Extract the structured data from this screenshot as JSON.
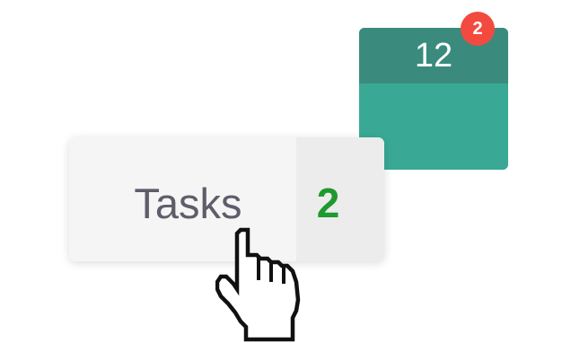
{
  "calendar": {
    "date_label": "12",
    "notification_count": "2",
    "colors": {
      "header": "#3a8b7d",
      "body": "#39a996",
      "badge": "#f24a3f"
    }
  },
  "tasks": {
    "label": "Tasks",
    "count": "2",
    "colors": {
      "label": "#5e5d69",
      "count": "#1e9a2e"
    }
  },
  "cursor": {
    "icon": "hand-pointer-icon"
  }
}
